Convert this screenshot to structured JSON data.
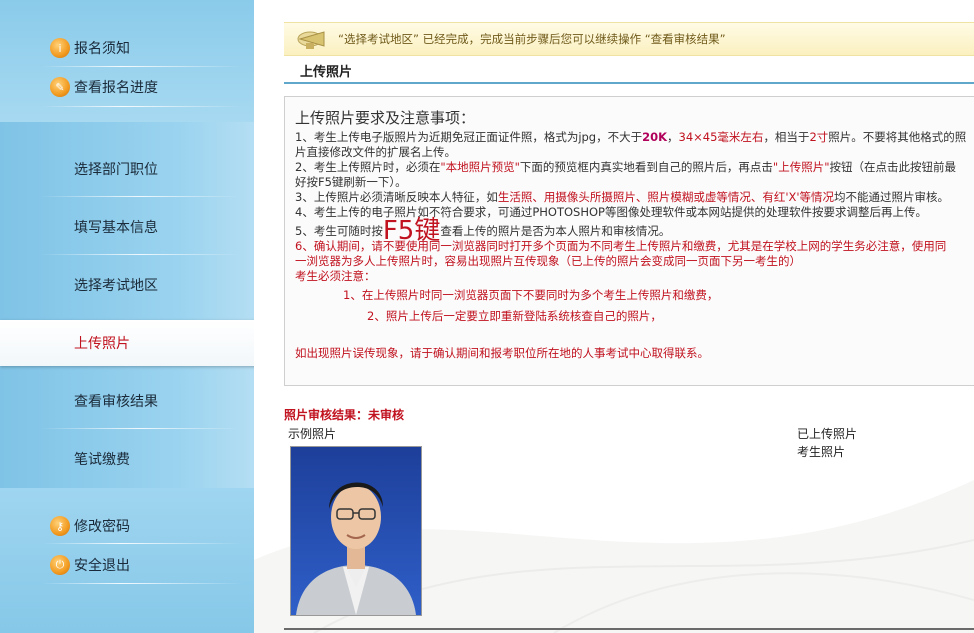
{
  "sidebar": {
    "top_links": [
      {
        "label": "报名须知",
        "icon": "info-icon"
      },
      {
        "label": "查看报名进度",
        "icon": "progress-icon"
      }
    ],
    "steps": [
      {
        "label": "选择部门职位"
      },
      {
        "label": "填写基本信息"
      },
      {
        "label": "选择考试地区"
      },
      {
        "label": "上传照片",
        "active": true
      },
      {
        "label": "查看审核结果"
      },
      {
        "label": "笔试缴费"
      }
    ],
    "bottom_links": [
      {
        "label": "修改密码",
        "icon": "key-icon"
      },
      {
        "label": "安全退出",
        "icon": "exit-icon"
      }
    ]
  },
  "notice": {
    "text": "“选择考试地区” 已经完成，完成当前步骤后您可以继续操作 “查看审核结果”"
  },
  "section": {
    "title": "上传照片"
  },
  "requirements": {
    "heading": "上传照片要求及注意事项：",
    "l1a": "1、考生上传电子版照片为近期免冠正面证件照，格式为jpg，不大于",
    "l1_size": "20K",
    "l1b": "，",
    "l1_dim": "34×45毫米左右",
    "l1c": "，相当于",
    "l1_inch": "2寸",
    "l1d": "照片。不要将其他格式的照",
    "l1e": "片直接修改文件的扩展名上传。",
    "l2a": "2、考生上传照片时，必须在",
    "l2_preview": "\"本地照片预览\"",
    "l2b": "下面的预览框内真实地看到自己的照片后，再点击",
    "l2_button": "\"上传照片\"",
    "l2c": "按钮（在点击此按钮前最",
    "l2d": "好按F5键刷新一下）。",
    "l3a": "3、上传照片必须清晰反映本人特征，如",
    "l3_bad": "生活照、用摄像头所摄照片、照片模糊或虚等情况、有红'X'等情况",
    "l3b": "均不能通过照片审核。",
    "l4": "4、考生上传的电子照片如不符合要求，可通过PHOTOSHOP等图像处理软件或本网站提供的处理软件按要求调整后再上传。",
    "l5a": "5、考生可随时按",
    "l5_key": "F5键",
    "l5b": "查看上传的照片是否为本人照片和审核情况。",
    "l6a": "6、确认期间，请不要使用同一浏览器同时打开多个页面为不同考生上传照片和缴费，尤其是在学校上网的学生务必注意，使用同",
    "l6b": "一浏览器为多人上传照片时，容易出现照片互传现象（已上传的照片会变成同一页面下另一考生的）",
    "l7": "考生必须注意：",
    "l8": "1、在上传照片时同一浏览器页面下不要同时为多个考生上传照片和缴费，",
    "l9": "2、照片上传后一定要立即重新登陆系统核查自己的照片，",
    "l10": "如出现照片误传现象，请于确认期间和报考职位所在地的人事考试中心取得联系。"
  },
  "result": {
    "label": "照片审核结果：未审核",
    "sample_label": "示例照片",
    "uploaded_label": "已上传照片",
    "student_label": "考生照片"
  },
  "colors": {
    "accent_red": "#c1121f",
    "sidebar_blue": "#8ccbea",
    "notice_bg": "#fbf0c0",
    "rule_blue": "#5fa8cc"
  }
}
